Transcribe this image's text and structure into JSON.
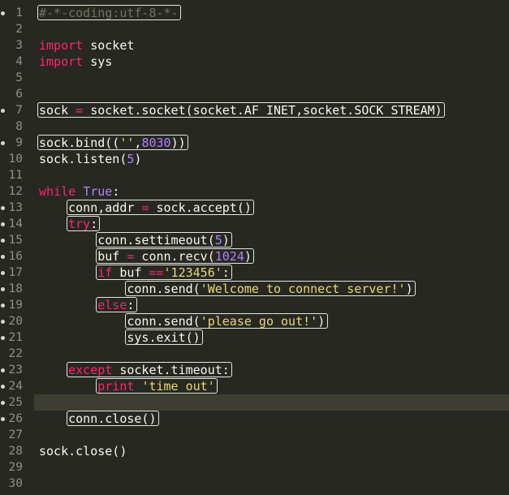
{
  "editor": {
    "language": "python",
    "theme_colors": {
      "background": "#272822",
      "active_line": "#3e3d32",
      "line_number": "#909087",
      "keyword": "#f92672",
      "constant": "#ae81ff",
      "string": "#e6db74",
      "comment": "#75715e",
      "plain": "#f8f8f2"
    },
    "active_line": 25,
    "lines": [
      {
        "n": "1",
        "marker": true,
        "tokens": [
          {
            "t": "#-*-coding:utf-8-*-",
            "c": "comment"
          }
        ]
      },
      {
        "n": "2",
        "tokens": []
      },
      {
        "n": "3",
        "tokens": [
          {
            "t": "import",
            "c": "kw"
          },
          {
            "t": " socket",
            "c": "plain"
          }
        ]
      },
      {
        "n": "4",
        "tokens": [
          {
            "t": "import",
            "c": "kw"
          },
          {
            "t": " sys",
            "c": "plain"
          }
        ]
      },
      {
        "n": "5",
        "tokens": []
      },
      {
        "n": "6",
        "tokens": []
      },
      {
        "n": "7",
        "marker": true,
        "tokens": [
          {
            "t": "sock ",
            "c": "plain"
          },
          {
            "t": "=",
            "c": "op"
          },
          {
            "t": " socket.socket(socket.AF_INET,socket.SOCK_STREAM)",
            "c": "plain"
          }
        ]
      },
      {
        "n": "8",
        "tokens": []
      },
      {
        "n": "9",
        "marker": true,
        "tokens": [
          {
            "t": "sock.bind((",
            "c": "plain"
          },
          {
            "t": "''",
            "c": "str"
          },
          {
            "t": ",",
            "c": "plain"
          },
          {
            "t": "8030",
            "c": "num"
          },
          {
            "t": "))",
            "c": "plain"
          }
        ]
      },
      {
        "n": "10",
        "tokens": [
          {
            "t": "sock.listen(",
            "c": "plain"
          },
          {
            "t": "5",
            "c": "num"
          },
          {
            "t": ")",
            "c": "plain"
          }
        ]
      },
      {
        "n": "11",
        "tokens": []
      },
      {
        "n": "12",
        "tokens": [
          {
            "t": "while",
            "c": "kw"
          },
          {
            "t": " ",
            "c": "plain"
          },
          {
            "t": "True",
            "c": "const"
          },
          {
            "t": ":",
            "c": "plain"
          }
        ]
      },
      {
        "n": "13",
        "marker": true,
        "tokens": [
          {
            "t": "    conn,addr ",
            "c": "plain"
          },
          {
            "t": "=",
            "c": "op"
          },
          {
            "t": " sock.accept()",
            "c": "plain"
          }
        ]
      },
      {
        "n": "14",
        "marker": true,
        "tokens": [
          {
            "t": "    ",
            "c": "plain"
          },
          {
            "t": "try",
            "c": "kw"
          },
          {
            "t": ":",
            "c": "plain"
          }
        ]
      },
      {
        "n": "15",
        "marker": true,
        "tokens": [
          {
            "t": "        conn.settimeout(",
            "c": "plain"
          },
          {
            "t": "5",
            "c": "num"
          },
          {
            "t": ")",
            "c": "plain"
          }
        ]
      },
      {
        "n": "16",
        "marker": true,
        "tokens": [
          {
            "t": "        buf ",
            "c": "plain"
          },
          {
            "t": "=",
            "c": "op"
          },
          {
            "t": " conn.recv(",
            "c": "plain"
          },
          {
            "t": "1024",
            "c": "num"
          },
          {
            "t": ")",
            "c": "plain"
          }
        ]
      },
      {
        "n": "17",
        "marker": true,
        "tokens": [
          {
            "t": "        ",
            "c": "plain"
          },
          {
            "t": "if",
            "c": "kw"
          },
          {
            "t": " buf ",
            "c": "plain"
          },
          {
            "t": "==",
            "c": "op"
          },
          {
            "t": "'123456'",
            "c": "str"
          },
          {
            "t": ":",
            "c": "plain"
          }
        ]
      },
      {
        "n": "18",
        "marker": true,
        "tokens": [
          {
            "t": "            conn.send(",
            "c": "plain"
          },
          {
            "t": "'Welcome to connect server!'",
            "c": "str"
          },
          {
            "t": ")",
            "c": "plain"
          }
        ]
      },
      {
        "n": "19",
        "marker": true,
        "tokens": [
          {
            "t": "        ",
            "c": "plain"
          },
          {
            "t": "else",
            "c": "kw"
          },
          {
            "t": ":",
            "c": "plain"
          }
        ]
      },
      {
        "n": "20",
        "marker": true,
        "tokens": [
          {
            "t": "            conn.send(",
            "c": "plain"
          },
          {
            "t": "'please go out!'",
            "c": "str"
          },
          {
            "t": ")",
            "c": "plain"
          }
        ]
      },
      {
        "n": "21",
        "marker": true,
        "tokens": [
          {
            "t": "            sys.exit()",
            "c": "plain"
          }
        ]
      },
      {
        "n": "22",
        "tokens": []
      },
      {
        "n": "23",
        "marker": true,
        "tokens": [
          {
            "t": "    ",
            "c": "plain"
          },
          {
            "t": "except",
            "c": "kw"
          },
          {
            "t": " socket.timeout:",
            "c": "plain"
          }
        ]
      },
      {
        "n": "24",
        "marker": true,
        "tokens": [
          {
            "t": "        ",
            "c": "plain"
          },
          {
            "t": "print",
            "c": "kw"
          },
          {
            "t": " ",
            "c": "plain"
          },
          {
            "t": "'time out'",
            "c": "str"
          }
        ]
      },
      {
        "n": "25",
        "marker": true,
        "tokens": []
      },
      {
        "n": "26",
        "marker": true,
        "tokens": [
          {
            "t": "    conn.close()",
            "c": "plain"
          }
        ]
      },
      {
        "n": "27",
        "tokens": []
      },
      {
        "n": "28",
        "tokens": [
          {
            "t": "sock.close()",
            "c": "plain"
          }
        ]
      },
      {
        "n": "29",
        "tokens": []
      },
      {
        "n": "30",
        "tokens": []
      }
    ]
  }
}
